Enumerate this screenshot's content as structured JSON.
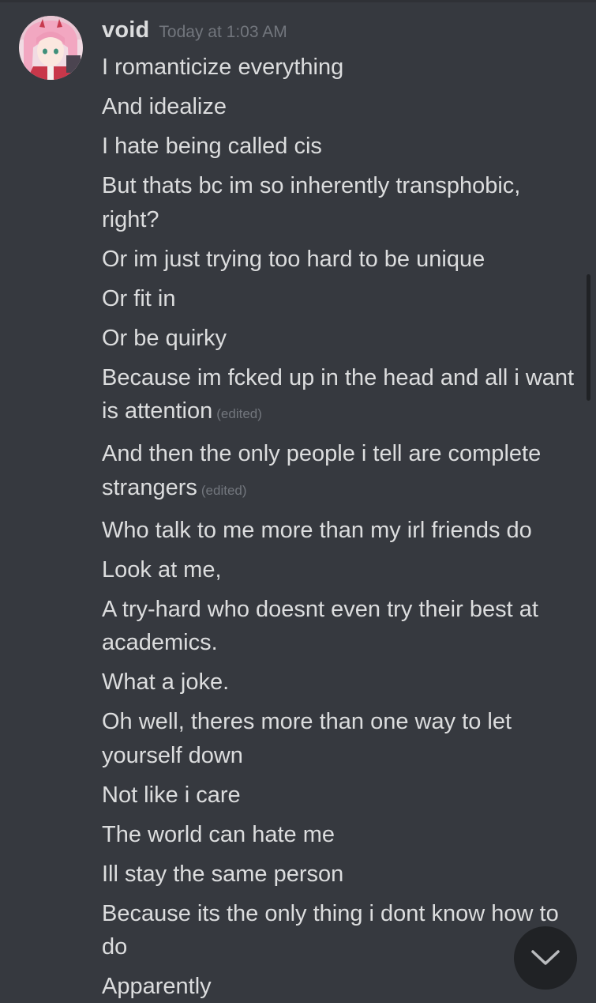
{
  "message_group": {
    "author": "void",
    "timestamp": "Today at 1:03 AM",
    "avatar_icon": "anime-avatar-pink-hair",
    "edited_label": "(edited)",
    "messages": [
      {
        "text": "I romanticize everything",
        "edited": ""
      },
      {
        "text": "And idealize",
        "edited": ""
      },
      {
        "text": "I hate being called cis",
        "edited": ""
      },
      {
        "text": "But thats bc im so inherently transphobic, right?",
        "edited": ""
      },
      {
        "text": "Or im just trying too hard to be unique",
        "edited": ""
      },
      {
        "text": "Or fit in",
        "edited": ""
      },
      {
        "text": "Or be quirky",
        "edited": ""
      },
      {
        "text": "Because im fcked up in the head and all i want is attention",
        "edited": "(edited)"
      },
      {
        "text": "And then the only people i tell are complete strangers",
        "edited": "(edited)"
      },
      {
        "text": "Who talk to me more than my irl friends do",
        "edited": ""
      },
      {
        "text": "Look at me,",
        "edited": ""
      },
      {
        "text": "A try-hard who doesnt even try their best at academics.",
        "edited": ""
      },
      {
        "text": "What a joke.",
        "edited": ""
      },
      {
        "text": "Oh well, theres more than one way to let yourself down",
        "edited": ""
      },
      {
        "text": "Not like i care",
        "edited": ""
      },
      {
        "text": "The world can hate me",
        "edited": ""
      },
      {
        "text": "Ill stay the same person",
        "edited": ""
      },
      {
        "text": "Because its the only thing i dont know how to do",
        "edited": ""
      },
      {
        "text": "Apparently",
        "edited": ""
      }
    ]
  },
  "jump_button": {
    "icon": "chevron-down-icon"
  },
  "colors": {
    "background": "#36393f",
    "text": "#dcddde",
    "muted": "#72767d",
    "button": "#202225"
  }
}
